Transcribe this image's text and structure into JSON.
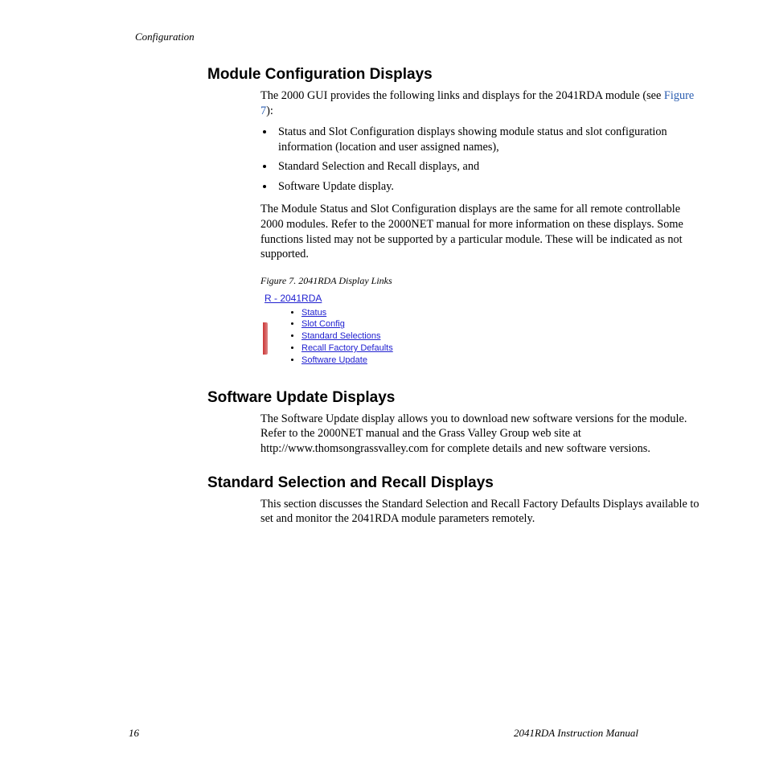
{
  "header": {
    "running": "Configuration"
  },
  "sections": {
    "modConfig": {
      "heading": "Module Configuration Displays",
      "intro_a": "The 2000 GUI provides the following links and displays for the 2041RDA module (see ",
      "intro_link": "Figure 7",
      "intro_b": "):",
      "bullets": [
        "Status and Slot Configuration displays showing module status and slot configuration information (location and user assigned names),",
        "Standard Selection and Recall displays, and",
        "Software Update display."
      ],
      "para2": "The Module Status and Slot Configuration displays are the same for all remote controllable 2000 modules. Refer to the 2000NET manual for more information on these displays. Some functions listed may not be supported by a particular module. These will be indicated as not supported.",
      "figure": {
        "caption": "Figure 7.  2041RDA Display Links",
        "title": "R - 2041RDA",
        "links": [
          "Status",
          "Slot Config",
          "Standard Selections",
          "Recall Factory Defaults",
          "Software Update"
        ]
      }
    },
    "softUpdate": {
      "heading": "Software Update Displays",
      "para": "The Software Update display allows you to download new software versions for the module. Refer to the 2000NET manual and the Grass Valley Group web site at http://www.thomsongrassvalley.com for complete details and new software versions."
    },
    "standardSel": {
      "heading": "Standard Selection and Recall Displays",
      "para": "This section discusses the Standard Selection and Recall Factory Defaults Displays available to set and monitor the 2041RDA module parameters remotely."
    }
  },
  "footer": {
    "page": "16",
    "manual": "2041RDA Instruction Manual"
  }
}
